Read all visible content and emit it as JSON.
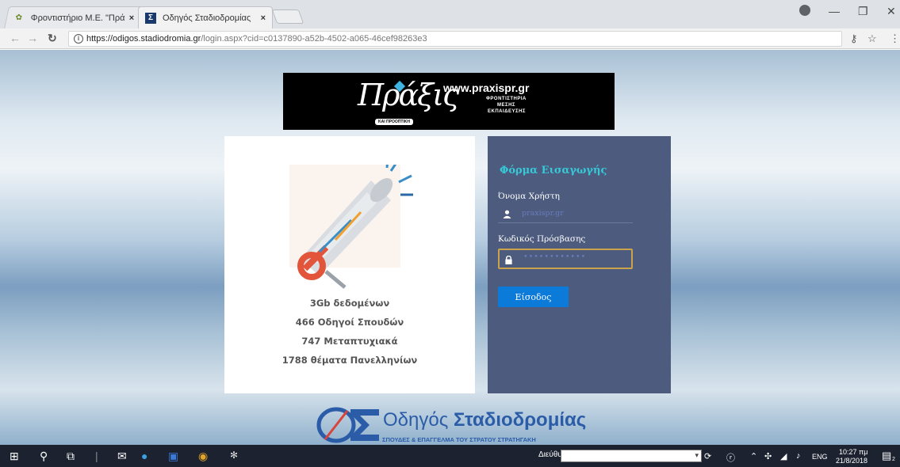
{
  "browser": {
    "tabs": [
      {
        "title": "Φροντιστήριο Μ.Ε. \"Πρά",
        "favicon": "praxis-leaf-icon",
        "active": false
      },
      {
        "title": "Οδηγός Σταδιοδρομίας",
        "favicon": "sigma-icon",
        "active": true
      }
    ],
    "close_glyph": "×",
    "url_host": "https://odigos.stadiodromia.gr",
    "url_path": "/login.aspx?cid=c0137890-a52b-4502-a065-46cef98263e3"
  },
  "banner": {
    "script_text": "Πράξις",
    "tagline": "ΚΑΙ ΠΡΟΟΠΤΙΚΗ",
    "website": "www.praxispr.gr",
    "lines": [
      "ΦΡΟΝΤΙΣΤΗΡΙΑ",
      "ΜΕΣΗΣ",
      "ΕΚΠΑΙΔΕΥΣΗΣ"
    ]
  },
  "info_panel": {
    "stats": [
      "3Gb δεδομένων",
      "466 Οδηγοί Σπουδών",
      "747 Μεταπτυχιακά",
      "1788 θέματα Πανελληνίων"
    ]
  },
  "login_form": {
    "title": "Φόρμα Εισαγωγής",
    "username_label": "Όνομα Χρήστη",
    "username_value": "praxispr.gr",
    "password_label": "Κωδικός Πρόσβασης",
    "password_value": "••••••••••••",
    "submit_label": "Είσοδος",
    "colors": {
      "panel": "#4c5b7e",
      "title": "#37c9d8",
      "button": "#0c7ad8"
    }
  },
  "footer_logo": {
    "text_regular": "Οδηγός ",
    "text_bold": "Σταδιοδρομίας",
    "subtitle": "ΣΠΟΥΔΕΣ & ΕΠΑΓΓΕΛΜΑ ΤΟΥ ΣΤΡΑΤΟΥ ΣΤΡΑΤΗΓΑΚΗ"
  },
  "taskbar": {
    "address_label": "Διεύθυνση",
    "language": "ENG",
    "time": "10:27 πμ",
    "date": "21/8/2018",
    "notification_count": "2"
  }
}
